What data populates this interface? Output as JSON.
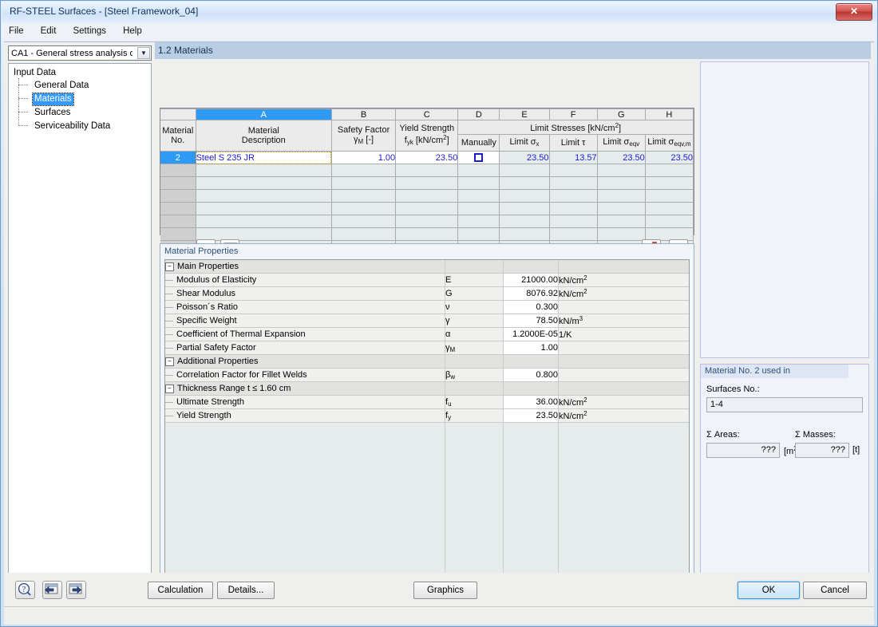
{
  "window": {
    "title": "RF-STEEL Surfaces - [Steel Framework_04]",
    "close_label": "✕"
  },
  "menu": {
    "items": [
      "File",
      "Edit",
      "Settings",
      "Help"
    ]
  },
  "sidebar": {
    "combo_value": "CA1 - General stress analysis of",
    "combo_arrow": "▼",
    "root_label": "Input Data",
    "items": [
      {
        "label": "General Data"
      },
      {
        "label": "Materials"
      },
      {
        "label": "Surfaces"
      },
      {
        "label": "Serviceability Data"
      }
    ]
  },
  "main": {
    "panel_title": "1.2 Materials",
    "grid": {
      "column_letters": [
        "A",
        "B",
        "C",
        "D",
        "E",
        "F",
        "G",
        "H"
      ],
      "group_header": "Limit Stresses [kN/cm",
      "group_header_sup": "2",
      "group_header_tail": "]",
      "headers": {
        "rowno_l1": "Material",
        "rowno_l2": "No.",
        "a_l1": "Material",
        "a_l2": "Description",
        "b_l1": "Safety Factor",
        "b_l2_sym": "γ",
        "b_l2_sub": "M",
        "b_l2_unit": "[-]",
        "c_l1": "Yield Strength",
        "c_l2_sym": "f",
        "c_l2_sub": "yk",
        "c_l2_unit": "[kN/cm",
        "c_l2_sup": "2",
        "c_l2_tail": "]",
        "d_l2": "Manually",
        "e_l2": "Limit σ",
        "e_l2_sub": "x",
        "f_l2": "Limit τ",
        "g_l2": "Limit σ",
        "g_l2_sub": "eqv",
        "h_l2": "Limit σ",
        "h_l2_sub": "eqv,m"
      },
      "rows": [
        {
          "no": "2",
          "description": "Steel S 235 JR",
          "safety_factor": "1.00",
          "yield_strength": "23.50",
          "manually": false,
          "limit_sigma_x": "23.50",
          "limit_tau": "13.57",
          "limit_sigma_eqv": "23.50",
          "limit_sigma_eqv_m": "23.50"
        }
      ],
      "empty_row_count": 8
    },
    "grid_toolbar": {
      "library_title": "Material Library",
      "import_title": "Import Material",
      "pick_title": "Select Material in Graphic",
      "view_title": "View Mode"
    },
    "properties": {
      "caption": "Material Properties",
      "groups": [
        {
          "label": "Main Properties",
          "expander": "−",
          "rows": [
            {
              "name": "Modulus of Elasticity",
              "symbol": "E",
              "symbol_sub": "",
              "value": "21000.00",
              "unit": "kN/cm",
              "unit_sup": "2"
            },
            {
              "name": "Shear Modulus",
              "symbol": "G",
              "symbol_sub": "",
              "value": "8076.92",
              "unit": "kN/cm",
              "unit_sup": "2"
            },
            {
              "name": "Poisson´s Ratio",
              "symbol": "ν",
              "symbol_sub": "",
              "value": "0.300",
              "unit": "",
              "unit_sup": ""
            },
            {
              "name": "Specific Weight",
              "symbol": "γ",
              "symbol_sub": "",
              "value": "78.50",
              "unit": "kN/m",
              "unit_sup": "3"
            },
            {
              "name": "Coefficient of Thermal Expansion",
              "symbol": "α",
              "symbol_sub": "",
              "value": "1.2000E-05",
              "unit": "1/K",
              "unit_sup": ""
            },
            {
              "name": "Partial Safety Factor",
              "symbol": "γ",
              "symbol_sub": "M",
              "value": "1.00",
              "unit": "",
              "unit_sup": ""
            }
          ]
        },
        {
          "label": "Additional Properties",
          "expander": "−",
          "rows": [
            {
              "name": "Correlation Factor for Fillet Welds",
              "symbol": "β",
              "symbol_sub": "w",
              "value": "0.800",
              "unit": "",
              "unit_sup": ""
            }
          ],
          "subgroup": {
            "label": "Thickness Range t ≤ 1.60 cm",
            "expander": "−",
            "rows": [
              {
                "name": "Ultimate Strength",
                "symbol": "f",
                "symbol_sub": "u",
                "value": "36.00",
                "unit": "kN/cm",
                "unit_sup": "2"
              },
              {
                "name": "Yield Strength",
                "symbol": "f",
                "symbol_sub": "y",
                "value": "23.50",
                "unit": "kN/cm",
                "unit_sup": "2"
              }
            ]
          }
        }
      ]
    }
  },
  "right_panel": {
    "usage": {
      "caption": "Material No. 2 used in",
      "surfaces_label": "Surfaces No.:",
      "surfaces_value": "1-4",
      "areas_label": "Σ Areas:",
      "areas_value": "???",
      "areas_unit_pre": "[m",
      "areas_unit_sup": "2",
      "areas_unit_post": "]",
      "masses_label": "Σ Masses:",
      "masses_value": "???",
      "masses_unit": "[t]"
    }
  },
  "footer": {
    "help_title": "Help",
    "prev_title": "Previous",
    "next_title": "Next",
    "calculation": "Calculation",
    "details": "Details...",
    "graphics": "Graphics",
    "ok": "OK",
    "cancel": "Cancel"
  }
}
